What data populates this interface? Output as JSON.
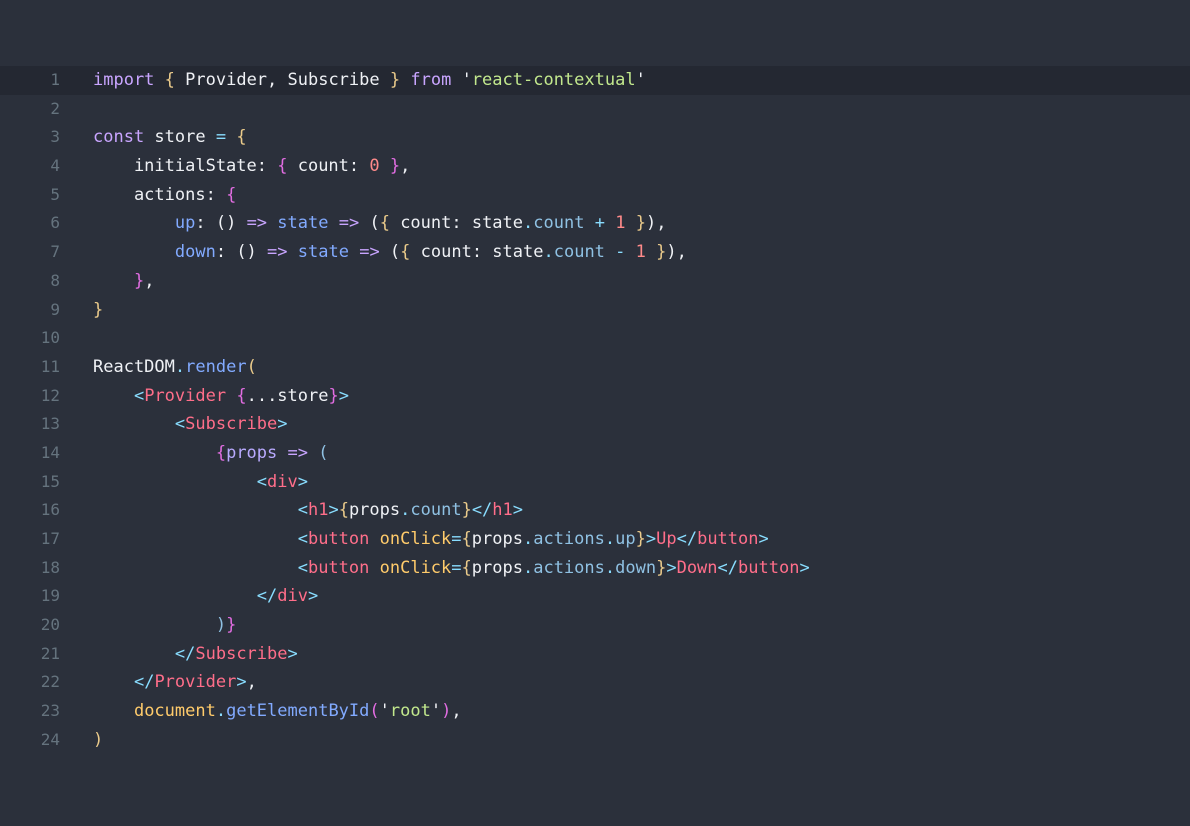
{
  "editor": {
    "active_line": 1,
    "lines": [
      {
        "n": "1",
        "tokens": [
          [
            "kw",
            "import"
          ],
          [
            "plain",
            " "
          ],
          [
            "brace",
            "{"
          ],
          [
            "plain",
            " Provider, Subscribe "
          ],
          [
            "brace",
            "}"
          ],
          [
            "plain",
            " "
          ],
          [
            "kw",
            "from"
          ],
          [
            "plain",
            " "
          ],
          [
            "quote",
            "'"
          ],
          [
            "str",
            "react-contextual"
          ],
          [
            "quote",
            "'"
          ]
        ]
      },
      {
        "n": "2",
        "tokens": []
      },
      {
        "n": "3",
        "tokens": [
          [
            "kw",
            "const"
          ],
          [
            "plain",
            " store "
          ],
          [
            "op",
            "="
          ],
          [
            "plain",
            " "
          ],
          [
            "brace",
            "{"
          ]
        ]
      },
      {
        "n": "4",
        "tokens": [
          [
            "plain",
            "    initialState: "
          ],
          [
            "brace2",
            "{"
          ],
          [
            "plain",
            " count: "
          ],
          [
            "num",
            "0"
          ],
          [
            "plain",
            " "
          ],
          [
            "brace2",
            "}"
          ],
          [
            "plain",
            ","
          ]
        ]
      },
      {
        "n": "5",
        "tokens": [
          [
            "plain",
            "    actions: "
          ],
          [
            "brace2",
            "{"
          ]
        ]
      },
      {
        "n": "6",
        "tokens": [
          [
            "plain",
            "        "
          ],
          [
            "fn",
            "up"
          ],
          [
            "plain",
            ": () "
          ],
          [
            "kw",
            "=>"
          ],
          [
            "plain",
            " "
          ],
          [
            "fn",
            "state"
          ],
          [
            "plain",
            " "
          ],
          [
            "kw",
            "=>"
          ],
          [
            "plain",
            " ("
          ],
          [
            "brace",
            "{"
          ],
          [
            "plain",
            " count: state"
          ],
          [
            "op",
            "."
          ],
          [
            "prop",
            "count"
          ],
          [
            "plain",
            " "
          ],
          [
            "op",
            "+"
          ],
          [
            "plain",
            " "
          ],
          [
            "num",
            "1"
          ],
          [
            "plain",
            " "
          ],
          [
            "brace",
            "}"
          ],
          [
            "plain",
            "),"
          ]
        ]
      },
      {
        "n": "7",
        "tokens": [
          [
            "plain",
            "        "
          ],
          [
            "fn",
            "down"
          ],
          [
            "plain",
            ": () "
          ],
          [
            "kw",
            "=>"
          ],
          [
            "plain",
            " "
          ],
          [
            "fn",
            "state"
          ],
          [
            "plain",
            " "
          ],
          [
            "kw",
            "=>"
          ],
          [
            "plain",
            " ("
          ],
          [
            "brace",
            "{"
          ],
          [
            "plain",
            " count: state"
          ],
          [
            "op",
            "."
          ],
          [
            "prop",
            "count"
          ],
          [
            "plain",
            " "
          ],
          [
            "op",
            "-"
          ],
          [
            "plain",
            " "
          ],
          [
            "num",
            "1"
          ],
          [
            "plain",
            " "
          ],
          [
            "brace",
            "}"
          ],
          [
            "plain",
            "),"
          ]
        ]
      },
      {
        "n": "8",
        "tokens": [
          [
            "plain",
            "    "
          ],
          [
            "brace2",
            "}"
          ],
          [
            "plain",
            ","
          ]
        ]
      },
      {
        "n": "9",
        "tokens": [
          [
            "brace",
            "}"
          ]
        ]
      },
      {
        "n": "10",
        "tokens": []
      },
      {
        "n": "11",
        "tokens": [
          [
            "plain",
            "ReactDOM"
          ],
          [
            "op",
            "."
          ],
          [
            "fn",
            "render"
          ],
          [
            "brace",
            "("
          ]
        ]
      },
      {
        "n": "12",
        "tokens": [
          [
            "plain",
            "    "
          ],
          [
            "punct",
            "<"
          ],
          [
            "tag",
            "Provider"
          ],
          [
            "plain",
            " "
          ],
          [
            "brace2",
            "{"
          ],
          [
            "plain",
            "...store"
          ],
          [
            "brace2",
            "}"
          ],
          [
            "punct",
            ">"
          ]
        ]
      },
      {
        "n": "13",
        "tokens": [
          [
            "plain",
            "        "
          ],
          [
            "punct",
            "<"
          ],
          [
            "tag",
            "Subscribe"
          ],
          [
            "punct",
            ">"
          ]
        ]
      },
      {
        "n": "14",
        "tokens": [
          [
            "plain",
            "            "
          ],
          [
            "brace2",
            "{"
          ],
          [
            "param",
            "props"
          ],
          [
            "plain",
            " "
          ],
          [
            "kw",
            "=>"
          ],
          [
            "plain",
            " "
          ],
          [
            "prop",
            "("
          ]
        ]
      },
      {
        "n": "15",
        "tokens": [
          [
            "plain",
            "                "
          ],
          [
            "punct",
            "<"
          ],
          [
            "tag",
            "div"
          ],
          [
            "punct",
            ">"
          ]
        ]
      },
      {
        "n": "16",
        "tokens": [
          [
            "plain",
            "                    "
          ],
          [
            "punct",
            "<"
          ],
          [
            "tag",
            "h1"
          ],
          [
            "punct",
            ">"
          ],
          [
            "brace",
            "{"
          ],
          [
            "plain",
            "props"
          ],
          [
            "op",
            "."
          ],
          [
            "prop",
            "count"
          ],
          [
            "brace",
            "}"
          ],
          [
            "punct",
            "</"
          ],
          [
            "tag",
            "h1"
          ],
          [
            "punct",
            ">"
          ]
        ]
      },
      {
        "n": "17",
        "tokens": [
          [
            "plain",
            "                    "
          ],
          [
            "punct",
            "<"
          ],
          [
            "tag",
            "button"
          ],
          [
            "plain",
            " "
          ],
          [
            "attr",
            "onClick"
          ],
          [
            "op",
            "="
          ],
          [
            "brace",
            "{"
          ],
          [
            "plain",
            "props"
          ],
          [
            "op",
            "."
          ],
          [
            "prop",
            "actions"
          ],
          [
            "op",
            "."
          ],
          [
            "prop",
            "up"
          ],
          [
            "brace",
            "}"
          ],
          [
            "punct",
            ">"
          ],
          [
            "tag",
            "Up"
          ],
          [
            "punct",
            "</"
          ],
          [
            "tag",
            "button"
          ],
          [
            "punct",
            ">"
          ]
        ]
      },
      {
        "n": "18",
        "tokens": [
          [
            "plain",
            "                    "
          ],
          [
            "punct",
            "<"
          ],
          [
            "tag",
            "button"
          ],
          [
            "plain",
            " "
          ],
          [
            "attr",
            "onClick"
          ],
          [
            "op",
            "="
          ],
          [
            "brace",
            "{"
          ],
          [
            "plain",
            "props"
          ],
          [
            "op",
            "."
          ],
          [
            "prop",
            "actions"
          ],
          [
            "op",
            "."
          ],
          [
            "prop",
            "down"
          ],
          [
            "brace",
            "}"
          ],
          [
            "punct",
            ">"
          ],
          [
            "tag",
            "Down"
          ],
          [
            "punct",
            "</"
          ],
          [
            "tag",
            "button"
          ],
          [
            "punct",
            ">"
          ]
        ]
      },
      {
        "n": "19",
        "tokens": [
          [
            "plain",
            "                "
          ],
          [
            "punct",
            "</"
          ],
          [
            "tag",
            "div"
          ],
          [
            "punct",
            ">"
          ]
        ]
      },
      {
        "n": "20",
        "tokens": [
          [
            "plain",
            "            "
          ],
          [
            "prop",
            ")"
          ],
          [
            "brace2",
            "}"
          ]
        ]
      },
      {
        "n": "21",
        "tokens": [
          [
            "plain",
            "        "
          ],
          [
            "punct",
            "</"
          ],
          [
            "tag",
            "Subscribe"
          ],
          [
            "punct",
            ">"
          ]
        ]
      },
      {
        "n": "22",
        "tokens": [
          [
            "plain",
            "    "
          ],
          [
            "punct",
            "</"
          ],
          [
            "tag",
            "Provider"
          ],
          [
            "punct",
            ">"
          ],
          [
            "plain",
            ","
          ]
        ]
      },
      {
        "n": "23",
        "tokens": [
          [
            "plain",
            "    "
          ],
          [
            "attr",
            "document"
          ],
          [
            "op",
            "."
          ],
          [
            "fn",
            "getElementById"
          ],
          [
            "brace2",
            "("
          ],
          [
            "quote",
            "'"
          ],
          [
            "str",
            "root"
          ],
          [
            "quote",
            "'"
          ],
          [
            "brace2",
            ")"
          ],
          [
            "plain",
            ","
          ]
        ]
      },
      {
        "n": "24",
        "tokens": [
          [
            "brace",
            ")"
          ]
        ]
      }
    ]
  }
}
